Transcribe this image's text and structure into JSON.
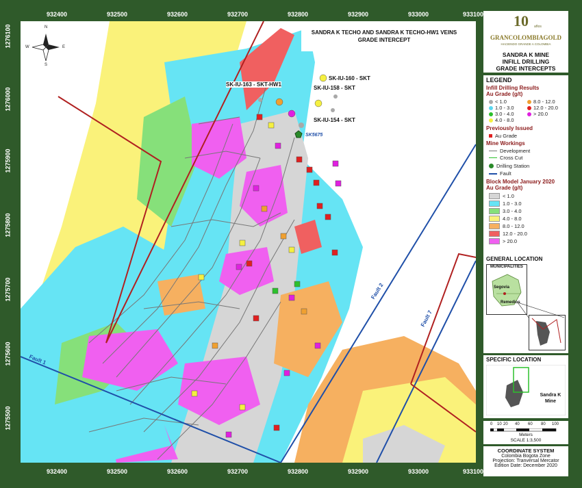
{
  "map": {
    "title_line1": "SANDRA K TECHO AND SANDRA K TECHO-HW1 VEINS",
    "title_line2": "GRADE INTERCEPT",
    "x_ticks": [
      "932400",
      "932500",
      "932600",
      "932700",
      "932800",
      "932900",
      "933000",
      "933100"
    ],
    "y_ticks": [
      "1276100",
      "1276000",
      "1275900",
      "1275800",
      "1275700",
      "1275600",
      "1275500"
    ],
    "labels": {
      "sk160": "SK-IU-160 - SKT",
      "sk163": "SK-IU-163 - SKT-HW1",
      "sk158": "SK-IU-158 - SKT",
      "sk154": "SK-IU-154 - SKT",
      "station": "SK5675",
      "fault1": "Fault 1",
      "fault2": "Fault 2",
      "fault7": "Fault 7"
    },
    "compass": {
      "n": "N",
      "s": "S",
      "e": "E",
      "w": "W"
    }
  },
  "logo": {
    "years": "10",
    "years_sub": "años",
    "brand": "GRANCOLOMBIAGOLD",
    "tagline": "HACIENDO GRANDE A COLOMBIA"
  },
  "heading": {
    "line1": "SANDRA K MINE",
    "line2": "INFILL DRILLING",
    "line3": "GRADE INTERCEPTS"
  },
  "legend": {
    "title": "LEGEND",
    "infill_title": "Infill Drilling Results",
    "infill_sub": "Au Grade (g/t)",
    "infill_items": [
      {
        "label": "< 1.0",
        "color": "#a9a9a9"
      },
      {
        "label": "8.0 - 12.0",
        "color": "#f0a030"
      },
      {
        "label": "1.0 - 3.0",
        "color": "#5ad8f0"
      },
      {
        "label": "12.0 - 20.0",
        "color": "#e02020"
      },
      {
        "label": "3.0 - 4.0",
        "color": "#2cc02c"
      },
      {
        "label": "> 20.0",
        "color": "#e020e0"
      },
      {
        "label": "4.0 - 8.0",
        "color": "#f5f040"
      }
    ],
    "prev_title": "Previously Issued",
    "prev_item": "Au Grade",
    "workings_title": "Mine Workings",
    "development": "Development",
    "crosscut": "Cross Cut",
    "drilling_station": "Drilling Station",
    "fault": "Fault",
    "block_title": "Block Model January 2020",
    "block_sub": "Au Grade (g/t)",
    "block_items": [
      {
        "label": "< 1.0",
        "color": "#d6d6d6"
      },
      {
        "label": "1.0 - 3.0",
        "color": "#66e4f4"
      },
      {
        "label": "3.0 - 4.0",
        "color": "#86e07a"
      },
      {
        "label": "4.0 - 8.0",
        "color": "#faf27a"
      },
      {
        "label": "8.0 - 12.0",
        "color": "#f6b060"
      },
      {
        "label": "12.0 - 20.0",
        "color": "#f06060"
      },
      {
        "label": "> 20.0",
        "color": "#f060f0"
      }
    ]
  },
  "general": {
    "title": "GENERAL LOCATION",
    "municipalities": "MUNICIPALITIES",
    "segovia": "Segovia",
    "remedios": "Remedios"
  },
  "specific": {
    "title": "SPECIFIC LOCATION",
    "mine_label": "Sandra K Mine"
  },
  "scale": {
    "ticks": [
      "0",
      "10",
      "20",
      "40",
      "60",
      "80",
      "100"
    ],
    "unit": "Meters",
    "ratio": "SCALE  1:3,500"
  },
  "coords": {
    "title": "COORDINATE SYSTEM",
    "line1": "Colombia Bogota Zone",
    "line2": "Projection: Tranversal Mercator",
    "edition": "Edition Date: December 2020"
  }
}
